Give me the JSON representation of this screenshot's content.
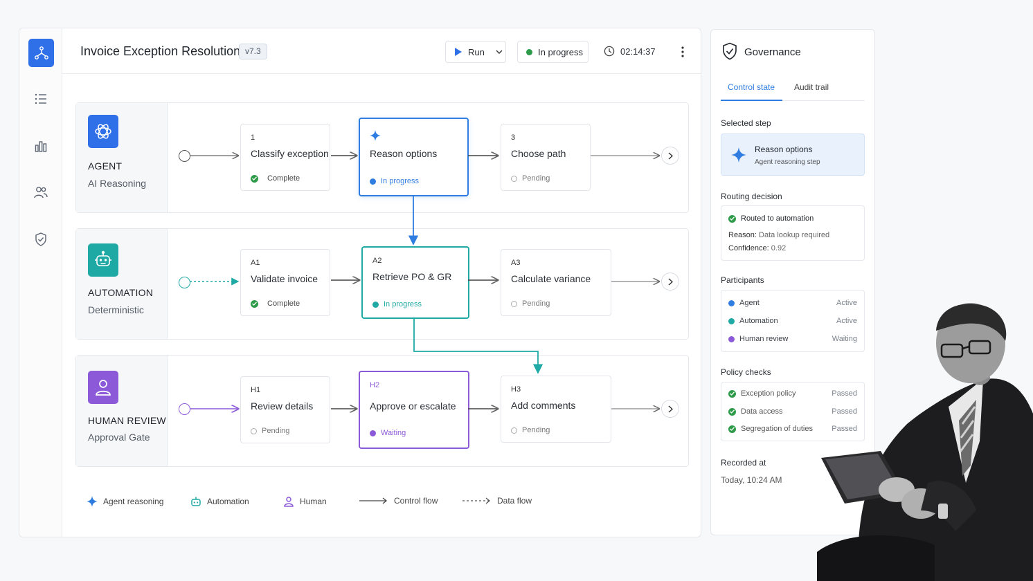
{
  "header": {
    "title": "Invoice Exception Resolution",
    "version": "v7.3",
    "run_label": "Run",
    "status": "In progress",
    "timer": "02:14:37"
  },
  "lanes": [
    {
      "name": "AGENT",
      "subtitle": "AI Reasoning",
      "steps": [
        {
          "id": "1",
          "name": "Classify exception",
          "status": "Complete"
        },
        {
          "id": "",
          "name": "Reason options",
          "status": "In progress"
        },
        {
          "id": "3",
          "name": "Choose path",
          "status": "Pending"
        }
      ]
    },
    {
      "name": "AUTOMATION",
      "subtitle": "Deterministic",
      "steps": [
        {
          "id": "A1",
          "name": "Validate invoice",
          "status": "Complete"
        },
        {
          "id": "A2",
          "name": "Retrieve PO & GR",
          "status": "In progress"
        },
        {
          "id": "A3",
          "name": "Calculate variance",
          "status": "Pending"
        }
      ]
    },
    {
      "name": "HUMAN REVIEW",
      "subtitle": "Approval Gate",
      "steps": [
        {
          "id": "H1",
          "name": "Review details",
          "status": "Pending"
        },
        {
          "id": "H2",
          "name": "Approve or escalate",
          "status": "Waiting"
        },
        {
          "id": "H3",
          "name": "Add comments",
          "status": "Pending"
        }
      ]
    }
  ],
  "legend": {
    "agent": "Agent reasoning",
    "automation": "Automation",
    "human": "Human",
    "control": "Control flow",
    "data": "Data flow"
  },
  "governance": {
    "title": "Governance",
    "tabs": [
      "Control state",
      "Audit trail"
    ],
    "selected_step_label": "Selected step",
    "selected_step": {
      "name": "Reason options",
      "desc": "Agent reasoning step"
    },
    "routing_label": "Routing decision",
    "routing": {
      "result": "Routed to automation",
      "reason_key": "Reason:",
      "reason_val": "Data lookup required",
      "confidence_key": "Confidence:",
      "confidence_val": "0.92"
    },
    "participants_label": "Participants",
    "participants": [
      {
        "name": "Agent",
        "state": "Active",
        "color": "#2f7de1"
      },
      {
        "name": "Automation",
        "state": "Active",
        "color": "#1fa9a4"
      },
      {
        "name": "Human review",
        "state": "Waiting",
        "color": "#8c5ad8"
      }
    ],
    "policy_label": "Policy checks",
    "policies": [
      {
        "name": "Exception policy",
        "state": "Passed"
      },
      {
        "name": "Data access",
        "state": "Passed"
      },
      {
        "name": "Segregation of duties",
        "state": "Passed"
      }
    ],
    "recorded_label": "Recorded at",
    "recorded_value": "Today, 10:24 AM"
  },
  "colors": {
    "agent": "#2f7de1",
    "automation": "#1fa9a4",
    "human": "#8c5ad8",
    "complete": "#2e9b4a"
  }
}
